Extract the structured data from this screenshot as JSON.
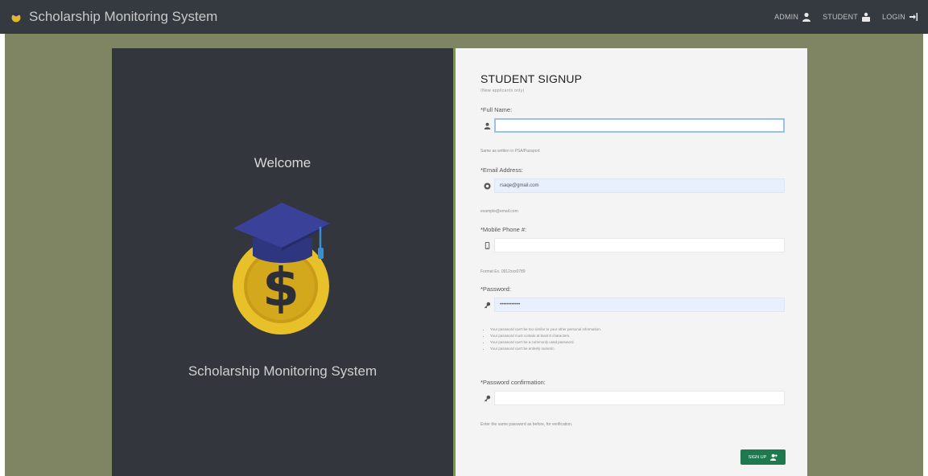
{
  "navbar": {
    "brand": "Scholarship Monitoring System",
    "links": [
      {
        "label": "ADMIN",
        "icon": "user-icon"
      },
      {
        "label": "STUDENT",
        "icon": "students-icon"
      },
      {
        "label": "LOGIN",
        "icon": "login-icon"
      }
    ]
  },
  "welcome": {
    "title": "Welcome",
    "system_name": "Scholarship Monitoring System",
    "logo": "graduation-coin-logo"
  },
  "form": {
    "title": "STUDENT SIGNUP",
    "subtitle": "(New applicants only)",
    "fields": [
      {
        "label": "*Full Name:",
        "value": "",
        "placeholder": "",
        "icon": "user-icon",
        "help": "Same as written in PSA/Passport"
      },
      {
        "label": "*Email Address:",
        "value": "rsaqe@gmail.com",
        "placeholder": "",
        "icon": "email-icon",
        "help": "example@email.com"
      },
      {
        "label": "*Mobile Phone #:",
        "value": "",
        "placeholder": "",
        "icon": "mobile-icon",
        "help": "Format Ex. 0912xxx0789"
      },
      {
        "label": "*Password:",
        "value": "••••••••••••",
        "placeholder": "",
        "icon": "key-icon",
        "help": ""
      },
      {
        "label": "*Password confirmation:",
        "value": "",
        "placeholder": "",
        "icon": "key-icon",
        "help": "Enter the same password as before, for verification."
      }
    ],
    "password_rules": [
      "Your password can't be too similar to your other personal information.",
      "Your password must contain at least 8 characters.",
      "Your password can't be a commonly used password.",
      "Your password can't be entirely numeric."
    ],
    "submit_label": "SIGN UP"
  },
  "colors": {
    "navbar": "#343a40",
    "page_background": "#7f8463",
    "welcome_panel": "#33363d",
    "form_panel": "#f4f4f4",
    "accent_border": "#7a9a3a",
    "signup_button": "#1e7a4e"
  }
}
